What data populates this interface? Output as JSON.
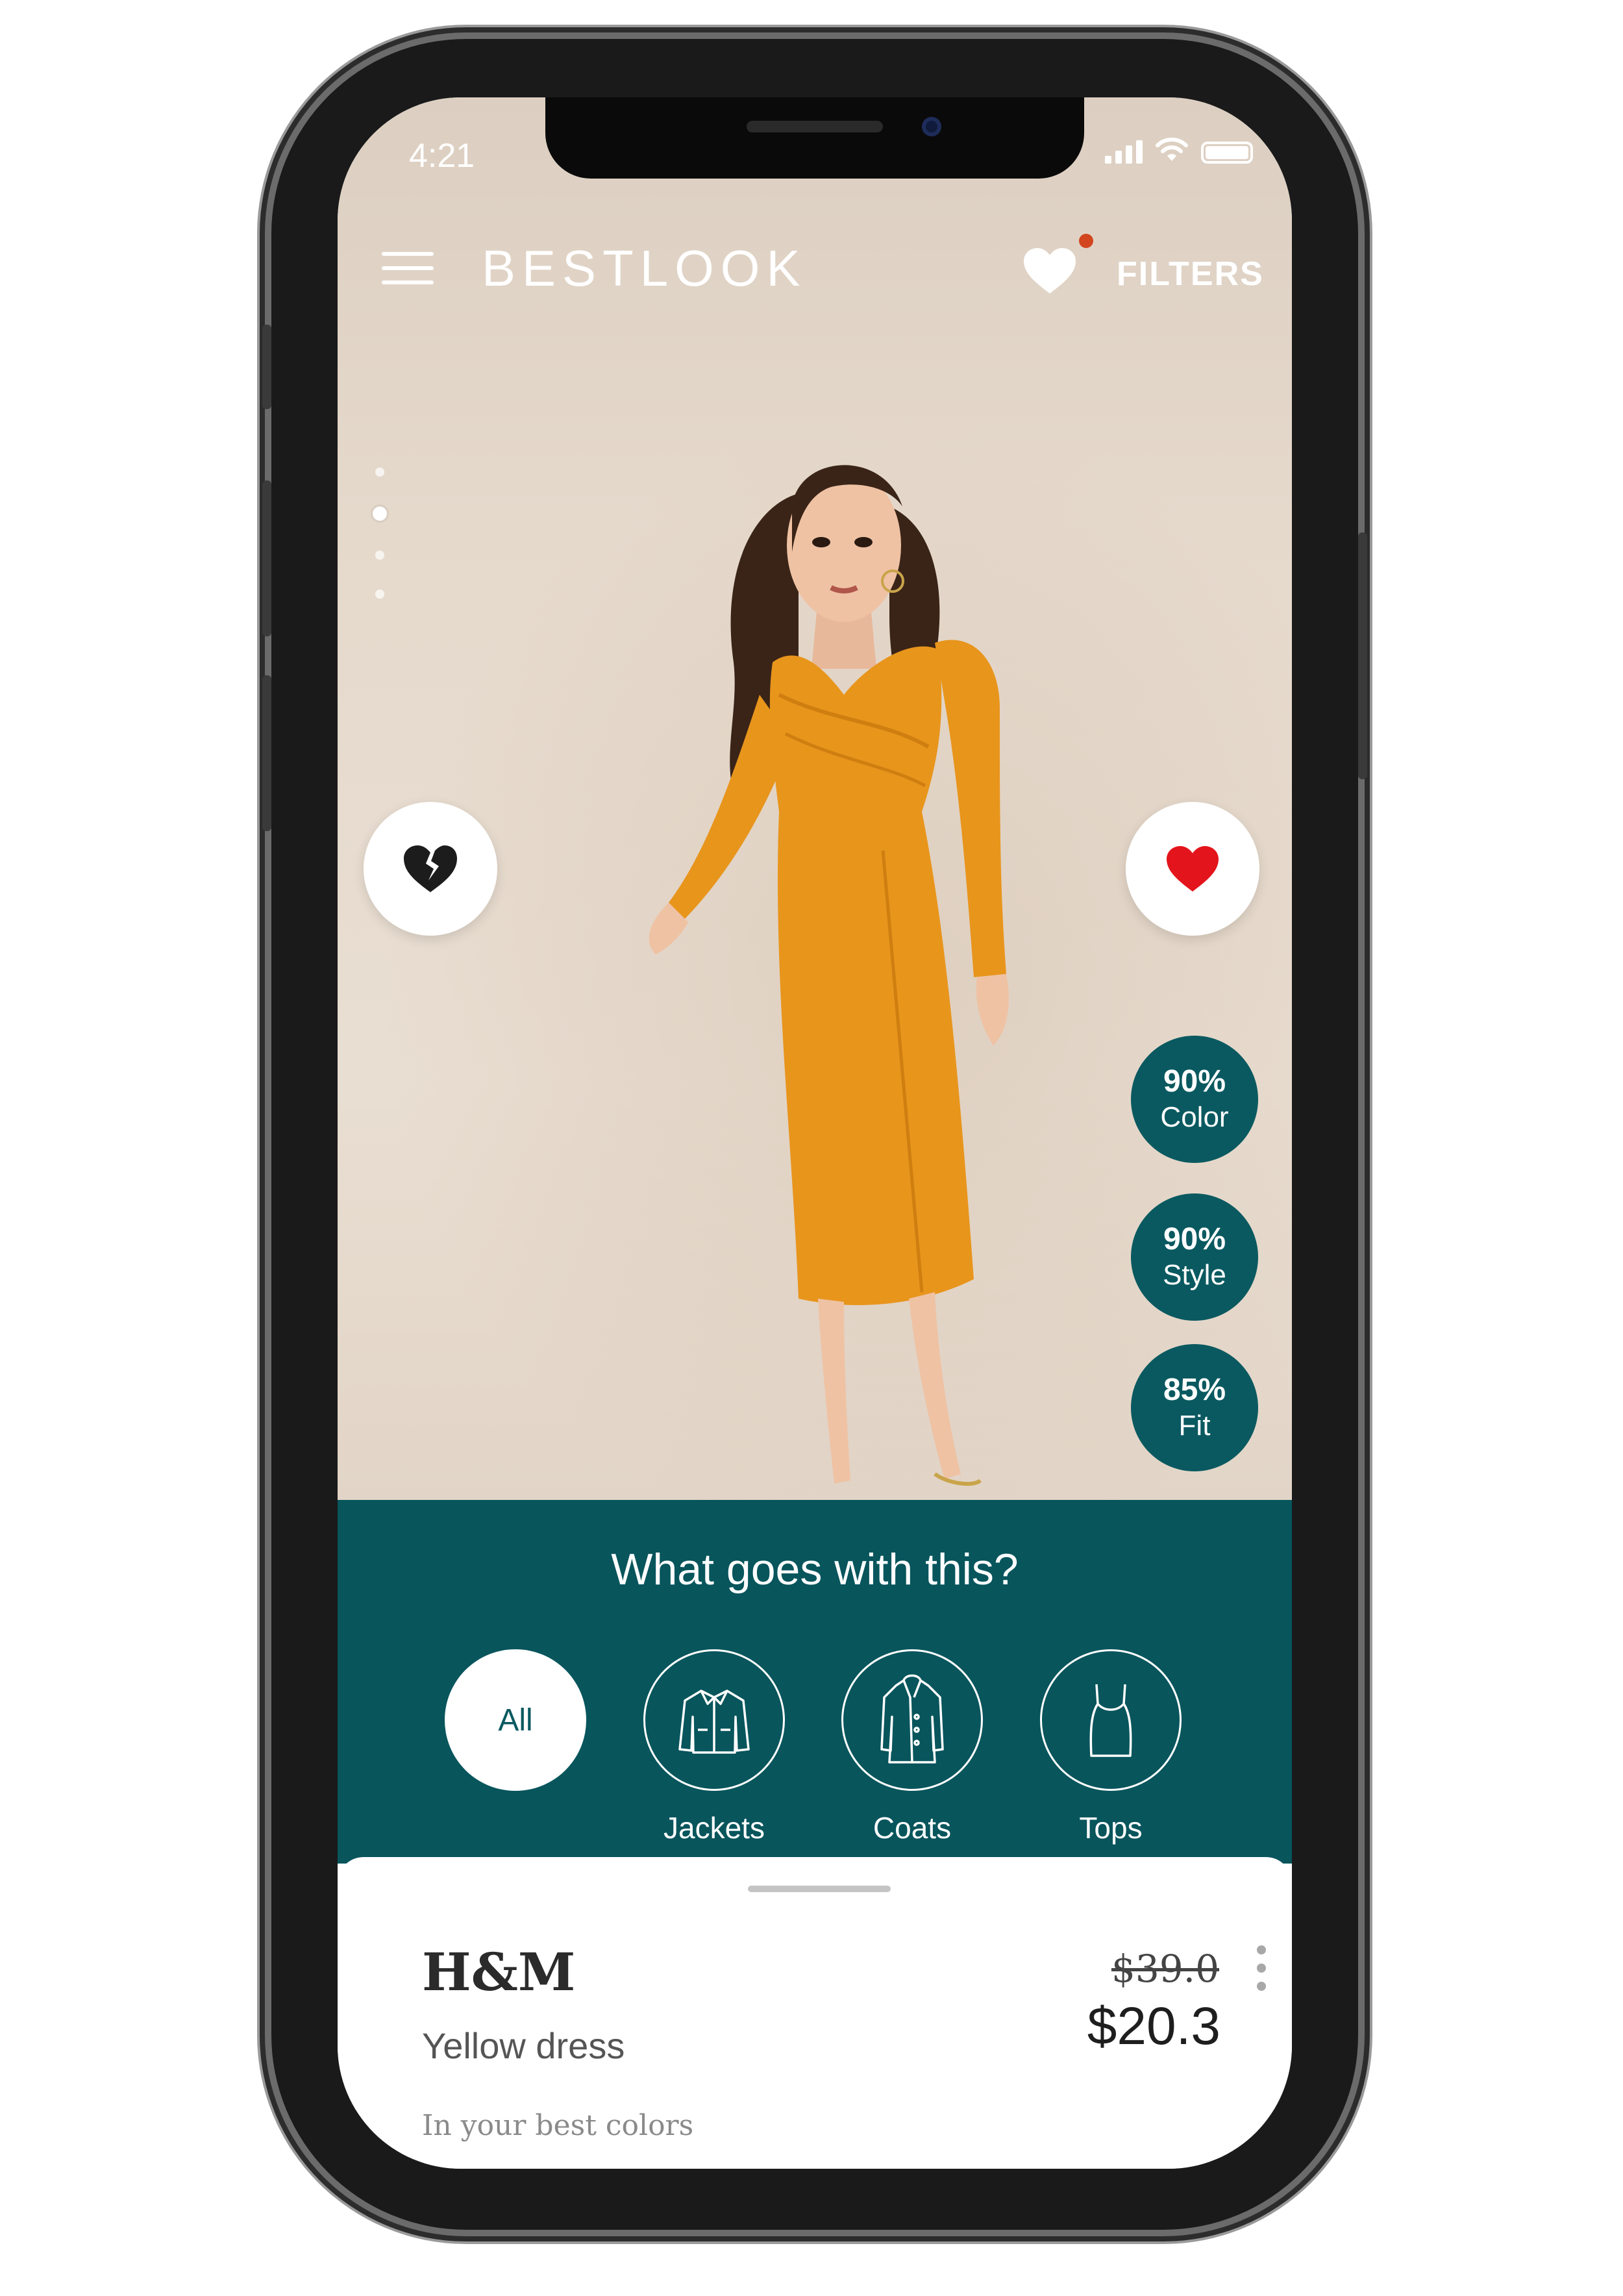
{
  "status_bar": {
    "time": "4:21"
  },
  "header": {
    "logo": "BESTLOOK",
    "filters_label": "FILTERS"
  },
  "carousel": {
    "pages": 4,
    "active_index": 1
  },
  "actions": {
    "dislike_icon": "broken-heart-icon",
    "like_icon": "heart-icon"
  },
  "scores": [
    {
      "percent": "90%",
      "label": "Color"
    },
    {
      "percent": "90%",
      "label": "Style"
    },
    {
      "percent": "85%",
      "label": "Fit"
    }
  ],
  "pairing": {
    "title": "What goes with this?",
    "categories": [
      {
        "label": "All",
        "selected": true
      },
      {
        "label": "Jackets",
        "icon": "jacket-icon"
      },
      {
        "label": "Coats",
        "icon": "coat-icon"
      },
      {
        "label": "Tops",
        "icon": "tank-top-icon"
      }
    ]
  },
  "product": {
    "brand": "H&M",
    "name": "Yellow dress",
    "old_price": "$39.0",
    "price": "$20.3",
    "colors_hint": "In your best colors"
  },
  "colors": {
    "teal": "#08555c",
    "accent_dot": "#d2451e",
    "like_red": "#e3141b",
    "dress": "#e8951c"
  }
}
